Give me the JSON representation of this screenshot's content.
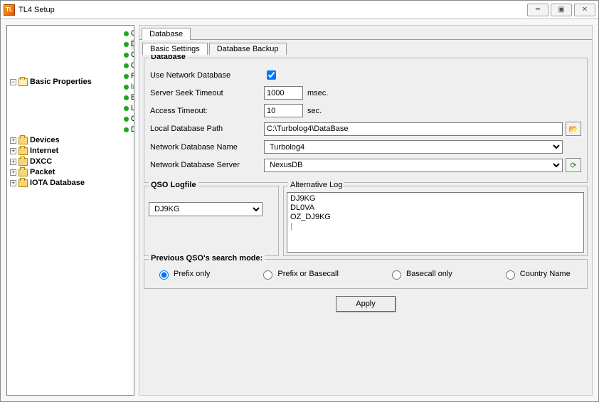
{
  "window": {
    "title": "TL4 Setup"
  },
  "tree": {
    "root": "Basic Properties",
    "children": [
      "General",
      "Database",
      "Call Book CD",
      "QRZ Database",
      "Personal Directories",
      "Inputline",
      "E-Mail Settings",
      "LOTW Support",
      "ClubLog Support",
      "Debug"
    ],
    "folders": [
      "Devices",
      "Internet",
      "DXCC",
      "Packet",
      "IOTA Database"
    ]
  },
  "tabs": {
    "top": "Database",
    "sub": [
      "Basic Settings",
      "Database Backup"
    ]
  },
  "db": {
    "legend": "Database",
    "use_label": "Use Network Database",
    "use_checked": true,
    "seek_label": "Server Seek Timeout",
    "seek_value": "1000",
    "seek_unit": "msec.",
    "access_label": "Access Timeout:",
    "access_value": "10",
    "access_unit": "sec.",
    "path_label": "Local Database Path",
    "path_value": "C:\\Turbolog4\\DataBase",
    "name_label": "Network Database Name",
    "name_value": "Turbolog4",
    "server_label": "Network Database Server",
    "server_value": "NexusDB"
  },
  "qso": {
    "legend": "QSO Logfile",
    "selected": "DJ9KG",
    "alt_legend": "Alternative Log",
    "alt_items": [
      "DJ9KG",
      "DL0VA",
      "OZ_DJ9KG"
    ]
  },
  "search": {
    "legend": "Previous QSO's search mode:",
    "options": [
      "Prefix only",
      "Prefix or Basecall",
      "Basecall only",
      "Country Name"
    ],
    "selected": 0
  },
  "buttons": {
    "apply": "Apply"
  }
}
